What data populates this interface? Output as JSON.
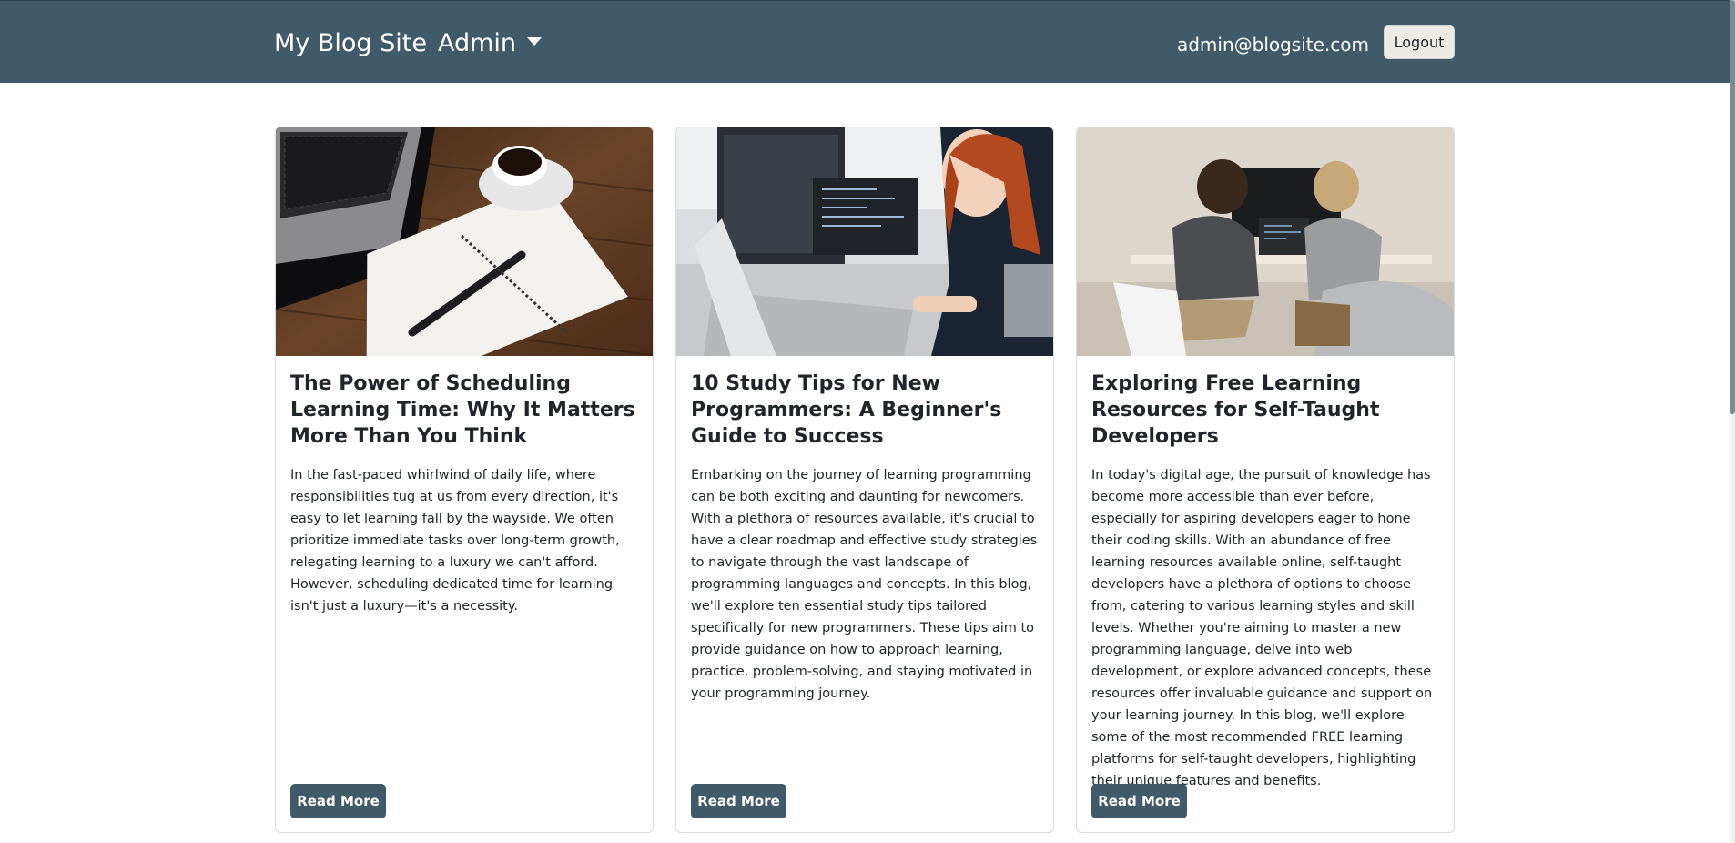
{
  "navbar": {
    "brand": "My Blog Site",
    "admin_menu": "Admin",
    "user_email": "admin@blogsite.com",
    "logout_label": "Logout",
    "background_color": "#405a6a"
  },
  "posts": [
    {
      "image_alt": "laptop, coffee cup and notebook with pen on a wooden desk",
      "title": "The Power of Scheduling Learning Time: Why It Matters More Than You Think",
      "excerpt": "In the fast-paced whirlwind of daily life, where responsibilities tug at us from every direction, it's easy to let learning fall by the wayside. We often prioritize immediate tasks over long-term growth, relegating learning to a luxury we can't afford. However, scheduling dedicated time for learning isn't just a luxury—it's a necessity.",
      "button_label": "Read More"
    },
    {
      "image_alt": "woman with red hair working at a computer with code on multiple monitors",
      "title": "10 Study Tips for New Programmers: A Beginner's Guide to Success",
      "excerpt": "Embarking on the journey of learning programming can be both exciting and daunting for newcomers. With a plethora of resources available, it's crucial to have a clear roadmap and effective study strategies to navigate through the vast landscape of programming languages and concepts. In this blog, we'll explore ten essential study tips tailored specifically for new programmers. These tips aim to provide guidance on how to approach learning, practice, problem-solving, and staying motivated in your programming journey.",
      "button_label": "Read More"
    },
    {
      "image_alt": "two young developers sitting at a desk looking at code on a monitor",
      "title": "Exploring Free Learning Resources for Self-Taught Developers",
      "excerpt": "In today's digital age, the pursuit of knowledge has become more accessible than ever before, especially for aspiring developers eager to hone their coding skills. With an abundance of free learning resources available online, self-taught developers have a plethora of options to choose from, catering to various learning styles and skill levels. Whether you're aiming to master a new programming language, delve into web development, or explore advanced concepts, these resources offer invaluable guidance and support on your learning journey. In this blog, we'll explore some of the most recommended FREE learning platforms for self-taught developers, highlighting their unique features and benefits.",
      "button_label": "Read More"
    }
  ],
  "icons": {
    "admin_caret": "chevron-down-icon"
  }
}
